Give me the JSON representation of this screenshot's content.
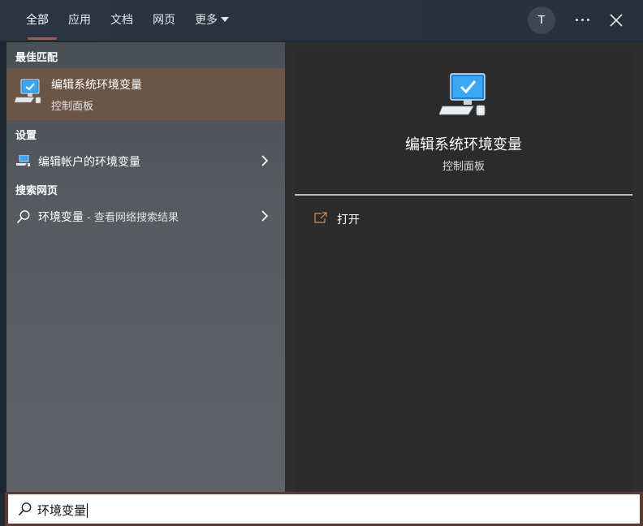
{
  "tabs": [
    {
      "label": "全部",
      "active": true
    },
    {
      "label": "应用"
    },
    {
      "label": "文档"
    },
    {
      "label": "网页"
    },
    {
      "label": "更多"
    }
  ],
  "user": {
    "avatar_letter": "T"
  },
  "sections": {
    "best_match": "最佳匹配",
    "settings": "设置",
    "web_search": "搜索网页"
  },
  "best_match": {
    "title": "编辑系统环境变量",
    "subtitle": "控制面板",
    "icon": "computer-check-icon"
  },
  "settings_item": {
    "label": "编辑帐户的环境变量",
    "icon": "settings-computer-icon"
  },
  "web_item": {
    "query": "环境变量",
    "suffix": " - 查看网络搜索结果",
    "icon": "search-icon"
  },
  "detail": {
    "title": "编辑系统环境变量",
    "subtitle": "控制面板",
    "actions": [
      {
        "label": "打开",
        "icon": "open-icon"
      }
    ]
  },
  "search": {
    "value": "环境变量"
  },
  "colors": {
    "accent": "#a0604a",
    "best_match_bg": "#6b5547",
    "search_border": "#5a3b30"
  }
}
